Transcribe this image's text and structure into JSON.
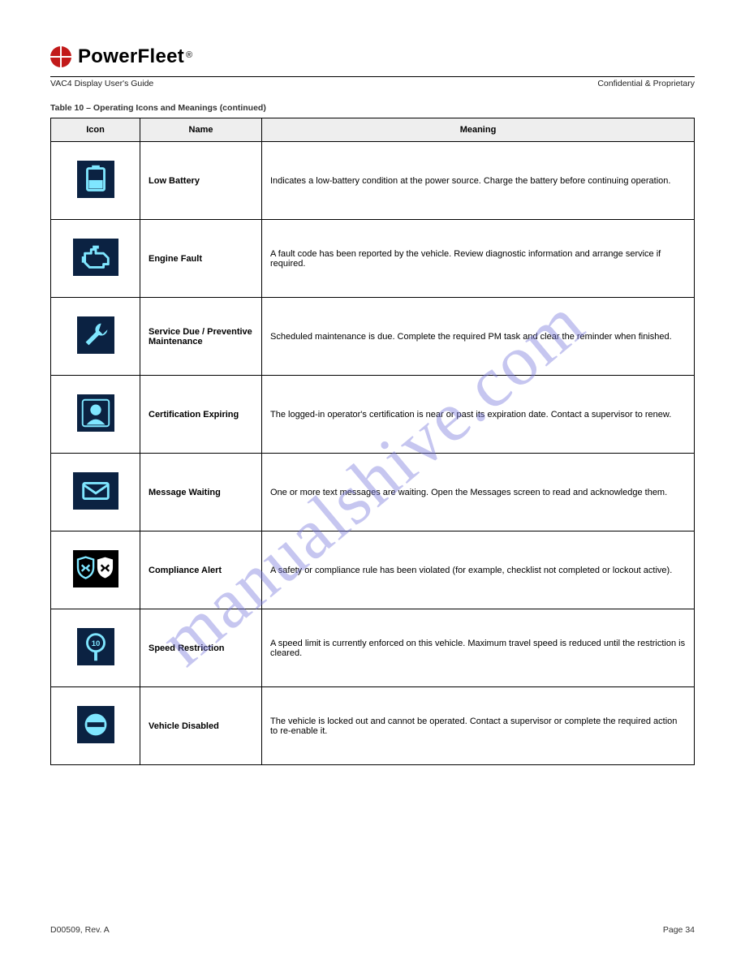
{
  "watermark": "manualshive.com",
  "header": {
    "brand": "PowerFleet",
    "registered": "®",
    "doc_title_left": "VAC4 Display User's Guide",
    "confidential": "Confidential & Proprietary"
  },
  "section": {
    "continued": "Table 10 – Operating Icons and Meanings (continued)"
  },
  "table": {
    "headers": {
      "icon": "Icon",
      "name": "Name",
      "meaning": "Meaning"
    },
    "rows": [
      {
        "icon_name": "battery-icon",
        "name": "Low Battery",
        "meaning": "Indicates a low-battery condition at the power source. Charge the battery before continuing operation."
      },
      {
        "icon_name": "engine-icon",
        "name": "Engine Fault",
        "meaning": "A fault code has been reported by the vehicle. Review diagnostic information and arrange service if required."
      },
      {
        "icon_name": "wrench-icon",
        "name": "Service Due / Preventive Maintenance",
        "meaning": "Scheduled maintenance is due. Complete the required PM task and clear the reminder when finished."
      },
      {
        "icon_name": "operator-icon",
        "name": "Certification Expiring",
        "meaning": "The logged-in operator's certification is near or past its expiration date. Contact a supervisor to renew."
      },
      {
        "icon_name": "message-icon",
        "name": "Message Waiting",
        "meaning": "One or more text messages are waiting. Open the Messages screen to read and acknowledge them."
      },
      {
        "icon_name": "shields-icon",
        "name": "Compliance Alert",
        "meaning": "A safety or compliance rule has been violated (for example, checklist not completed or lockout active)."
      },
      {
        "icon_name": "speed-sign-icon",
        "name": "Speed Restriction",
        "meaning": "A speed limit is currently enforced on this vehicle. Maximum travel speed is reduced until the restriction is cleared."
      },
      {
        "icon_name": "prohibit-icon",
        "name": "Vehicle Disabled",
        "meaning": "The vehicle is locked out and cannot be operated. Contact a supervisor or complete the required action to re-enable it."
      }
    ]
  },
  "footer": {
    "doc_no": "D00509, Rev. A",
    "page": "Page 34"
  }
}
